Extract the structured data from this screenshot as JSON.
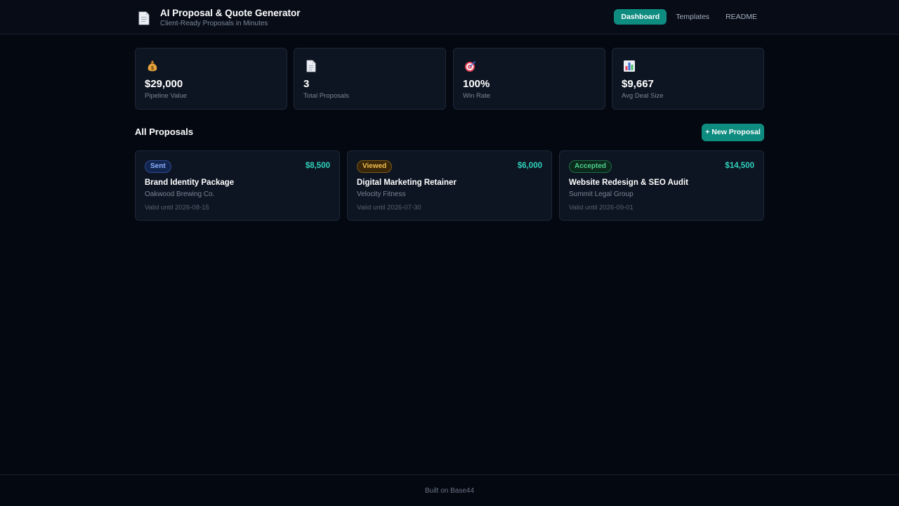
{
  "header": {
    "title": "AI Proposal & Quote Generator",
    "subtitle": "Client-Ready Proposals in Minutes",
    "nav": [
      {
        "label": "Dashboard",
        "active": true
      },
      {
        "label": "Templates",
        "active": false
      },
      {
        "label": "README",
        "active": false
      }
    ]
  },
  "stats": [
    {
      "icon": "money-bag-icon",
      "value": "$29,000",
      "label": "Pipeline Value"
    },
    {
      "icon": "document-icon",
      "value": "3",
      "label": "Total Proposals"
    },
    {
      "icon": "target-icon",
      "value": "100%",
      "label": "Win Rate"
    },
    {
      "icon": "bar-chart-icon",
      "value": "$9,667",
      "label": "Avg Deal Size"
    }
  ],
  "proposals_section": {
    "title": "All Proposals",
    "new_button": "+ New Proposal",
    "items": [
      {
        "status": "Sent",
        "amount": "$8,500",
        "title": "Brand Identity Package",
        "client": "Oakwood Brewing Co.",
        "valid": "Valid until 2026-08-15"
      },
      {
        "status": "Viewed",
        "amount": "$6,000",
        "title": "Digital Marketing Retainer",
        "client": "Velocity Fitness",
        "valid": "Valid until 2026-07-30"
      },
      {
        "status": "Accepted",
        "amount": "$14,500",
        "title": "Website Redesign & SEO Audit",
        "client": "Summit Legal Group",
        "valid": "Valid until 2026-09-01"
      }
    ]
  },
  "footer": {
    "text": "Built on Base44"
  },
  "colors": {
    "accent": "#0f8c80",
    "amount": "#2fd3bd",
    "background": "#040811",
    "card": "#0e1522",
    "status_sent": "#8fb4ff",
    "status_viewed": "#f2c14e",
    "status_accepted": "#4fd18b"
  }
}
